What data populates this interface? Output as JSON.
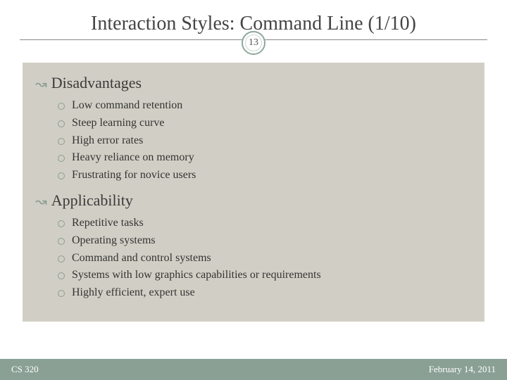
{
  "title": "Interaction Styles: Command Line (1/10)",
  "page_number": "13",
  "sections": [
    {
      "heading": "Disadvantages",
      "items": [
        "Low command retention",
        "Steep learning curve",
        "High error rates",
        "Heavy reliance on memory",
        "Frustrating for novice users"
      ]
    },
    {
      "heading": "Applicability",
      "items": [
        "Repetitive tasks",
        "Operating systems",
        "Command and control systems",
        "Systems with low graphics capabilities or requirements",
        "Highly efficient, expert use"
      ]
    }
  ],
  "footer": {
    "left": "CS 320",
    "right": "February 14, 2011"
  },
  "colors": {
    "accent": "#8aa094",
    "content_bg": "#d1cfc5"
  }
}
